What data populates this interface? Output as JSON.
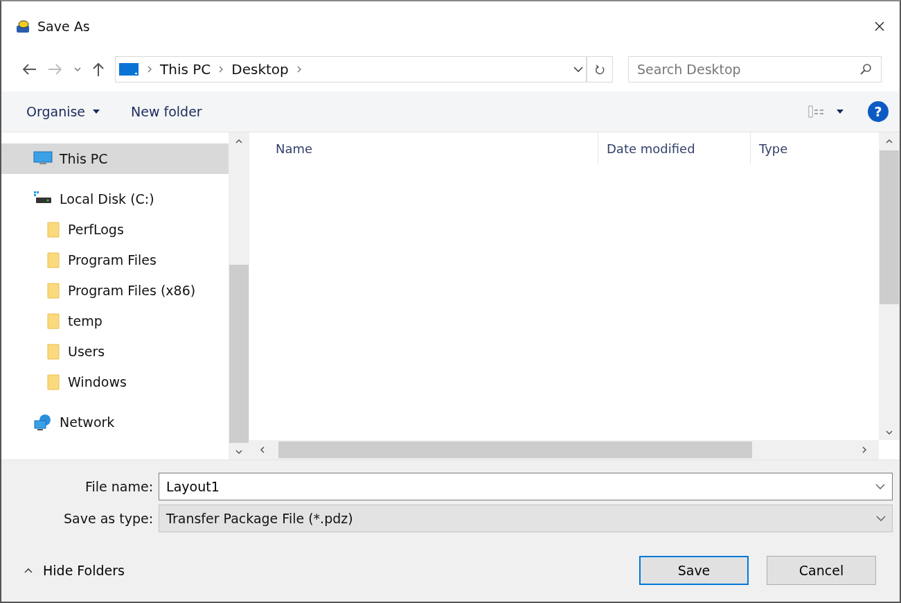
{
  "window": {
    "title": "Save As"
  },
  "address_bar": {
    "path": [
      "This PC",
      "Desktop"
    ]
  },
  "search": {
    "placeholder": "Search Desktop"
  },
  "toolbar": {
    "organise": "Organise",
    "new_folder": "New folder",
    "help": "?"
  },
  "sidebar": {
    "items": [
      {
        "label": "This PC",
        "kind": "pc",
        "selected": true
      },
      {
        "label": "Local Disk (C:)",
        "kind": "disk",
        "selected": false,
        "children": [
          {
            "label": "PerfLogs",
            "kind": "folder",
            "selected": false
          },
          {
            "label": "Program Files",
            "kind": "folder",
            "selected": false
          },
          {
            "label": "Program Files (x86)",
            "kind": "folder",
            "selected": false
          },
          {
            "label": "temp",
            "kind": "folder",
            "selected": false
          },
          {
            "label": "Users",
            "kind": "folder",
            "selected": false
          },
          {
            "label": "Windows",
            "kind": "folder",
            "selected": false
          }
        ]
      },
      {
        "label": "Network",
        "kind": "network",
        "selected": false
      }
    ]
  },
  "table": {
    "columns": [
      "Name",
      "Date modified",
      "Type"
    ]
  },
  "form": {
    "file_name_label": "File name:",
    "file_name": "Layout1",
    "type_label": "Save as type:",
    "type_value": "Transfer Package File (*.pdz)"
  },
  "footer": {
    "hide_folders": "Hide Folders",
    "buttons": [
      {
        "label": "Save",
        "kind": "primary"
      },
      {
        "label": "Cancel",
        "kind": "normal"
      }
    ]
  }
}
